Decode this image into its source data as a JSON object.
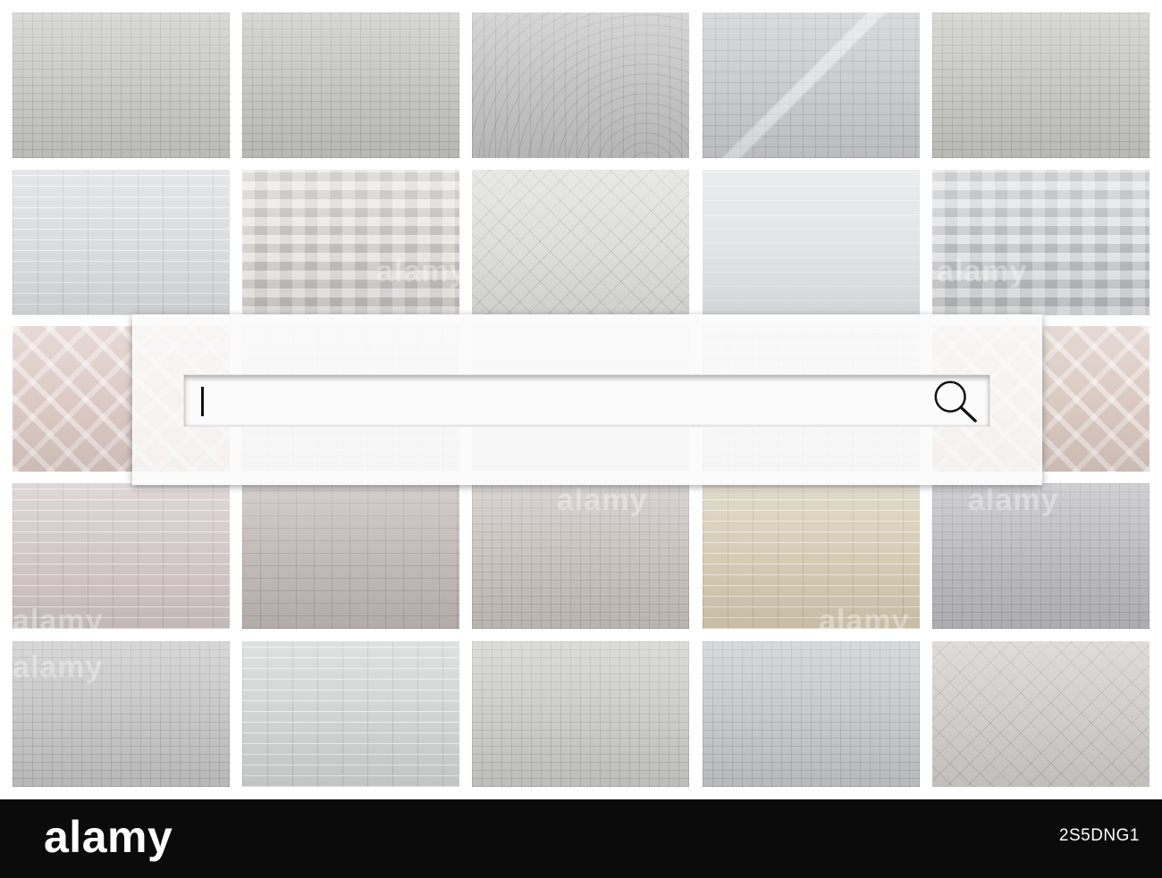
{
  "search": {
    "value": "",
    "placeholder": ""
  },
  "watermark": {
    "text": "alamy"
  },
  "banner": {
    "brand": "alamy",
    "image_id": "2S5DNG1"
  },
  "icons": {
    "search_button": "magnifier-icon"
  },
  "colors": {
    "banner_background": "#0b0b0b",
    "banner_text": "#ffffff",
    "panel_background": "#fafafa",
    "caret": "#111111"
  },
  "tiles": [
    {
      "base": "#c6c6c4",
      "pattern": "cobble"
    },
    {
      "base": "#c2c3c0",
      "pattern": "cobble"
    },
    {
      "base": "#c0c0c1",
      "pattern": "fan"
    },
    {
      "base": "#c7c8cb",
      "pattern": "tiles"
    },
    {
      "base": "#c4c4c0",
      "pattern": "cobble"
    },
    {
      "base": "#d9dadc",
      "pattern": "brick"
    },
    {
      "base": "#d3d1cd",
      "pattern": "checker"
    },
    {
      "base": "#dcdcda",
      "pattern": "diamond"
    },
    {
      "base": "#e1e2e4",
      "pattern": "plain"
    },
    {
      "base": "#c9cacc",
      "pattern": "checker"
    },
    {
      "base": "#d9c6c0",
      "pattern": "lattice"
    },
    {
      "base": "#e4e4e4",
      "pattern": "brick"
    },
    {
      "base": "#e6e6e6",
      "pattern": "plain"
    },
    {
      "base": "#e2e2e2",
      "pattern": "brick"
    },
    {
      "base": "#d7c6bd",
      "pattern": "lattice"
    },
    {
      "base": "#cfc3c3",
      "pattern": "brick"
    },
    {
      "base": "#bfb5b5",
      "pattern": "parquet"
    },
    {
      "base": "#c6bfbb",
      "pattern": "cobble"
    },
    {
      "base": "#d3c8b0",
      "pattern": "brick"
    },
    {
      "base": "#b8b8bb",
      "pattern": "cobble"
    },
    {
      "base": "#c3c3c3",
      "pattern": "cobble"
    },
    {
      "base": "#cfd0d0",
      "pattern": "brick"
    },
    {
      "base": "#c9c9c8",
      "pattern": "cobble"
    },
    {
      "base": "#c4c5c6",
      "pattern": "cobble"
    },
    {
      "base": "#cdcac7",
      "pattern": "diamond"
    }
  ]
}
